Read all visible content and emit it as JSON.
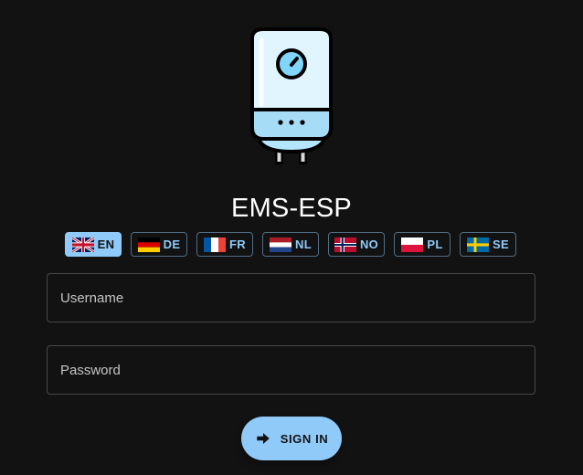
{
  "app": {
    "title": "EMS-ESP",
    "logo_icon": "boiler-icon"
  },
  "languages": {
    "selected": "EN",
    "items": [
      {
        "code": "EN",
        "flag": "uk-flag-icon"
      },
      {
        "code": "DE",
        "flag": "germany-flag-icon"
      },
      {
        "code": "FR",
        "flag": "france-flag-icon"
      },
      {
        "code": "NL",
        "flag": "netherlands-flag-icon"
      },
      {
        "code": "NO",
        "flag": "norway-flag-icon"
      },
      {
        "code": "PL",
        "flag": "poland-flag-icon"
      },
      {
        "code": "SE",
        "flag": "sweden-flag-icon"
      }
    ]
  },
  "form": {
    "username": {
      "placeholder": "Username",
      "value": ""
    },
    "password": {
      "placeholder": "Password",
      "value": ""
    },
    "signin": {
      "label": "SIGN IN",
      "icon": "login-arrow-icon"
    }
  },
  "colors": {
    "background": "#121212",
    "accent": "#90caf9"
  }
}
